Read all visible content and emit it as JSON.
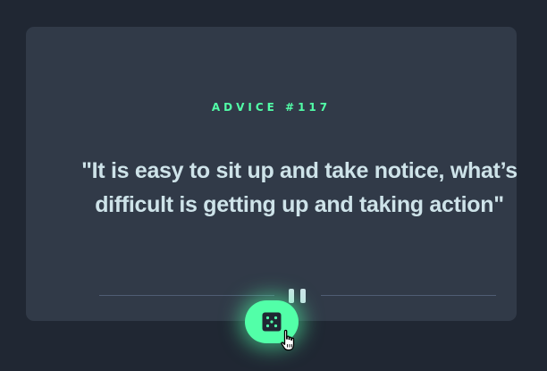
{
  "card": {
    "advice_label": "ADVICE #117",
    "quote": "\"It is easy to sit up and take notice, what’s difficult is getting up and taking action\""
  },
  "divider": {
    "icon": "pause-icon"
  },
  "button": {
    "icon": "dice-icon"
  },
  "cursor": {
    "icon": "hand-pointer-icon"
  },
  "colors": {
    "background": "#202733",
    "card": "#313a48",
    "accent": "#52ffa8",
    "text": "#cee3e9",
    "divider": "#4f5d74"
  }
}
